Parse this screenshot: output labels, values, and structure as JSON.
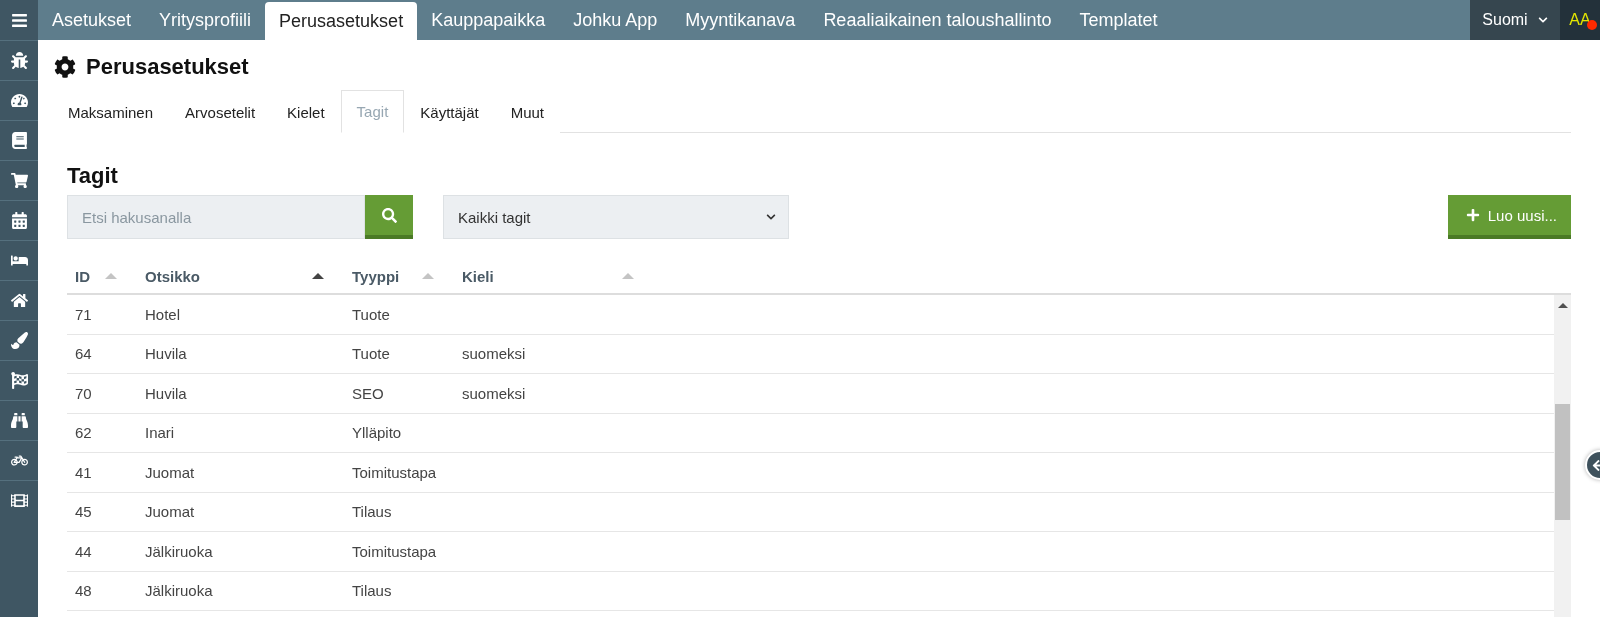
{
  "top_tabs": [
    {
      "label": "Asetukset",
      "selected": false
    },
    {
      "label": "Yritysprofiili",
      "selected": false
    },
    {
      "label": "Perusasetukset",
      "selected": true
    },
    {
      "label": "Kauppapaikka",
      "selected": false
    },
    {
      "label": "Johku App",
      "selected": false
    },
    {
      "label": "Myyntikanava",
      "selected": false
    },
    {
      "label": "Reaaliaikainen taloushallinto",
      "selected": false
    },
    {
      "label": "Templatet",
      "selected": false
    }
  ],
  "language": "Suomi",
  "avatar": {
    "initials": "AA",
    "notification": true
  },
  "page_title": "Perusasetukset",
  "sub_tabs": [
    {
      "label": "Maksaminen",
      "selected": false
    },
    {
      "label": "Arvosetelit",
      "selected": false
    },
    {
      "label": "Kielet",
      "selected": false
    },
    {
      "label": "Tagit",
      "selected": true
    },
    {
      "label": "Käyttäjät",
      "selected": false
    },
    {
      "label": "Muut",
      "selected": false
    }
  ],
  "section_title": "Tagit",
  "search": {
    "placeholder": "Etsi hakusanalla"
  },
  "filter": {
    "value": "Kaikki tagit"
  },
  "create_button": "Luo uusi...",
  "table": {
    "columns": [
      {
        "label": "ID",
        "sorted": false
      },
      {
        "label": "Otsikko",
        "sorted": true
      },
      {
        "label": "Tyyppi",
        "sorted": false
      },
      {
        "label": "Kieli",
        "sorted": false
      }
    ],
    "rows": [
      [
        "71",
        "Hotel",
        "Tuote",
        ""
      ],
      [
        "64",
        "Huvila",
        "Tuote",
        "suomeksi"
      ],
      [
        "70",
        "Huvila",
        "SEO",
        "suomeksi"
      ],
      [
        "62",
        "Inari",
        "Ylläpito",
        ""
      ],
      [
        "41",
        "Juomat",
        "Toimitustapa",
        ""
      ],
      [
        "45",
        "Juomat",
        "Tilaus",
        ""
      ],
      [
        "44",
        "Jälkiruoka",
        "Toimitustapa",
        ""
      ],
      [
        "48",
        "Jälkiruoka",
        "Tilaus",
        ""
      ]
    ]
  }
}
